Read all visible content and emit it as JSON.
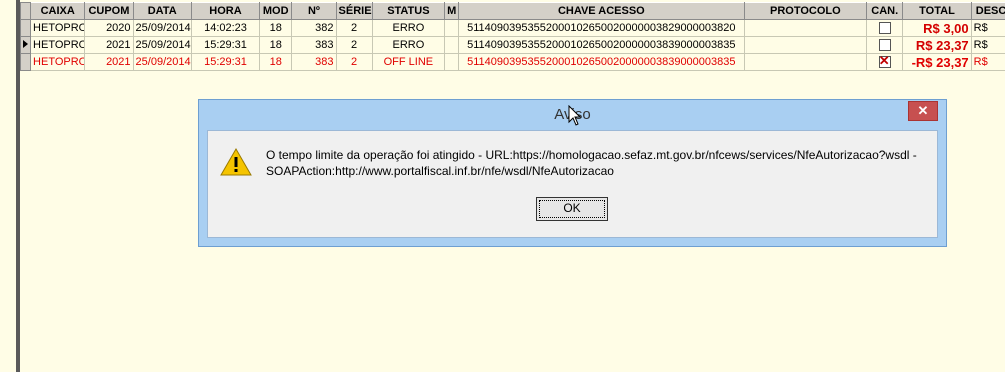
{
  "grid": {
    "headers": [
      "CAIXA",
      "CUPOM",
      "DATA",
      "HORA",
      "MOD",
      "Nº",
      "SÉRIE",
      "STATUS",
      "M",
      "CHAVE ACESSO",
      "PROTOCOLO",
      "CAN.",
      "TOTAL",
      "DESCO"
    ],
    "rows": [
      {
        "caixa": "HETOPRO",
        "cupom": "2020",
        "data": "25/09/2014",
        "hora": "14:02:23",
        "mod": "18",
        "num": "382",
        "serie": "2",
        "status": "ERRO",
        "m": "",
        "chave": "51140903953552000102650020000003829000003820",
        "protocolo": "",
        "can": false,
        "total": "R$ 3,00",
        "desco": "R$"
      },
      {
        "caixa": "HETOPRO",
        "cupom": "2021",
        "data": "25/09/2014",
        "hora": "15:29:31",
        "mod": "18",
        "num": "383",
        "serie": "2",
        "status": "ERRO",
        "m": "",
        "chave": "51140903953552000102650020000003839000003835",
        "protocolo": "",
        "can": false,
        "total": "R$ 23,37",
        "desco": "R$"
      },
      {
        "caixa": "HETOPRO",
        "cupom": "2021",
        "data": "25/09/2014",
        "hora": "15:29:31",
        "mod": "18",
        "num": "383",
        "serie": "2",
        "status": "OFF LINE",
        "m": "",
        "chave": "51140903953552000102650020000003839000003835",
        "protocolo": "",
        "can": true,
        "total": "-R$ 23,37",
        "desco": "R$"
      }
    ]
  },
  "dialog": {
    "title": "Aviso",
    "close_label": "✕",
    "message": "O tempo limite da operação foi atingido - URL:https://homologacao.sefaz.mt.gov.br/nfcews/services/NfeAutorizacao?wsdl - SOAPAction:http://www.portalfiscal.inf.br/nfe/wsdl/NfeAutorizacao",
    "ok_label": "OK"
  },
  "icons": {
    "warning": "warning-icon",
    "cursor": "mouse-cursor-icon",
    "close": "close-icon"
  },
  "colors": {
    "error_row": "#e00000",
    "total": "#d40000",
    "dialog_frame": "#a9cff2",
    "close_button": "#c75050"
  }
}
